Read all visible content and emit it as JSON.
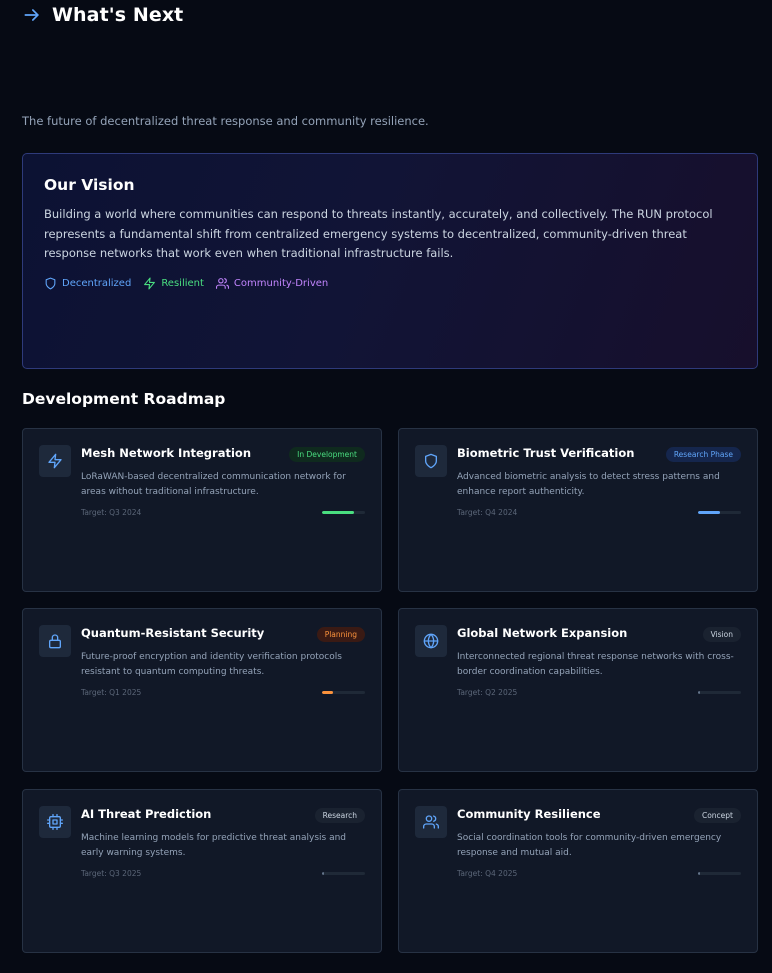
{
  "header": {
    "title": "What's Next",
    "icon": "arrow-right-icon"
  },
  "subtitle": "The future of decentralized threat response and community resilience.",
  "vision": {
    "title": "Our Vision",
    "body": "Building a world where communities can respond to threats instantly, accurately, and collectively. The RUN protocol represents a fundamental shift from centralized emergency systems to decentralized, community-driven threat response networks that work even when traditional infrastructure fails.",
    "tags": [
      {
        "label": "Decentralized",
        "icon": "shield-icon",
        "color": "#60a5fa"
      },
      {
        "label": "Resilient",
        "icon": "lightning-icon",
        "color": "#4ade80"
      },
      {
        "label": "Community-Driven",
        "icon": "users-icon",
        "color": "#c084fc"
      }
    ]
  },
  "roadmap": {
    "title": "Development Roadmap",
    "items": [
      {
        "title": "Mesh Network Integration",
        "status": "In Development",
        "description": "LoRaWAN-based decentralized communication network for areas without traditional infrastructure.",
        "target": "Target: Q3 2024",
        "icon": "lightning-icon",
        "progress": 0.75,
        "color": "#4ade80"
      },
      {
        "title": "Biometric Trust Verification",
        "status": "Research Phase",
        "description": "Advanced biometric analysis to detect stress patterns and enhance report authenticity.",
        "target": "Target: Q4 2024",
        "icon": "shield-icon",
        "progress": 0.5,
        "color": "#60a5fa"
      },
      {
        "title": "Quantum-Resistant Security",
        "status": "Planning",
        "description": "Future-proof encryption and identity verification protocols resistant to quantum computing threats.",
        "target": "Target: Q1 2025",
        "icon": "lock-icon",
        "progress": 0.25,
        "color": "#fb923c"
      },
      {
        "title": "Global Network Expansion",
        "status": "Vision",
        "description": "Interconnected regional threat response networks with cross-border coordination capabilities.",
        "target": "Target: Q2 2025",
        "icon": "globe-icon",
        "progress": 0.05,
        "color": "#64748b"
      },
      {
        "title": "AI Threat Prediction",
        "status": "Research",
        "description": "Machine learning models for predictive threat analysis and early warning systems.",
        "target": "Target: Q3 2025",
        "icon": "cpu-icon",
        "progress": 0.05,
        "color": "#64748b"
      },
      {
        "title": "Community Resilience",
        "status": "Concept",
        "description": "Social coordination tools for community-driven emergency response and mutual aid.",
        "target": "Target: Q4 2025",
        "icon": "users-icon",
        "progress": 0.05,
        "color": "#64748b"
      }
    ]
  }
}
